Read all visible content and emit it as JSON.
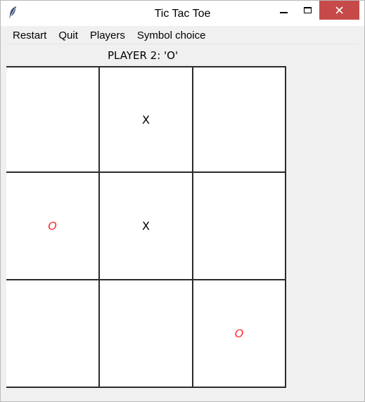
{
  "window": {
    "title": "Tic Tac Toe",
    "icon": "feather-icon"
  },
  "menu": {
    "items": [
      "Restart",
      "Quit",
      "Players",
      "Symbol choice"
    ]
  },
  "status": {
    "text": "PLAYER 2: 'O'"
  },
  "board": {
    "cells": [
      "",
      "X",
      "",
      "O",
      "X",
      "",
      "",
      "",
      "O"
    ]
  },
  "colors": {
    "x": "#000000",
    "o": "#ff2a2a",
    "close_button": "#c74a4a",
    "grid": "#2b2b2b"
  }
}
